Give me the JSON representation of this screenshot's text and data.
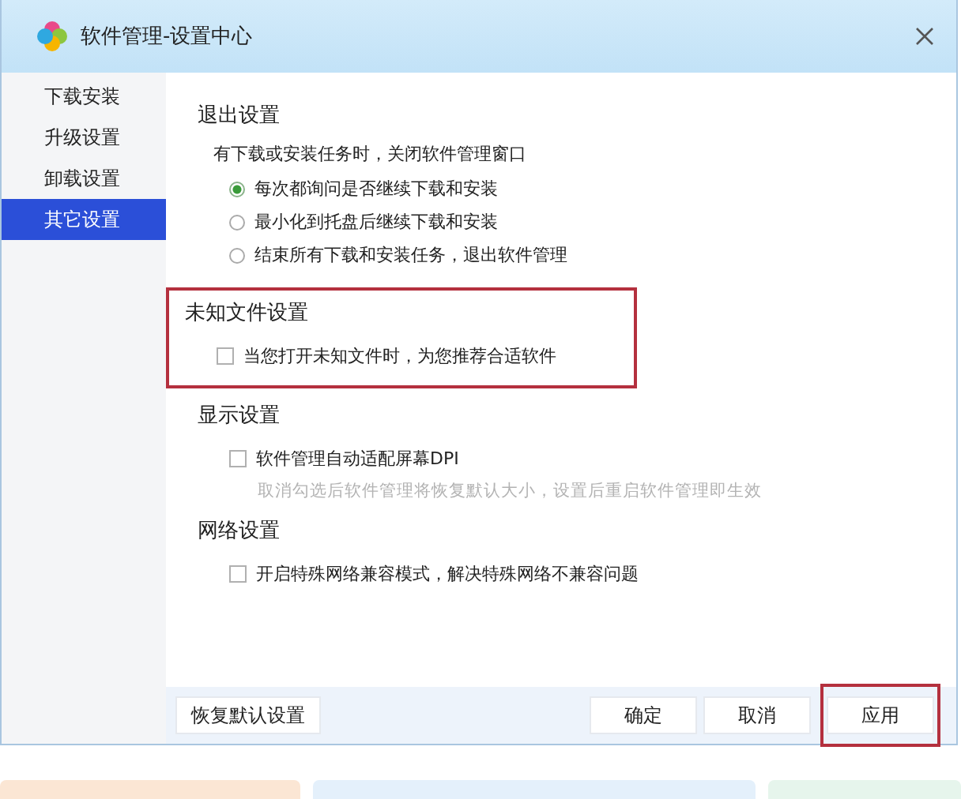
{
  "window": {
    "title": "软件管理-设置中心"
  },
  "sidebar": {
    "items": [
      {
        "label": "下载安装",
        "selected": false
      },
      {
        "label": "升级设置",
        "selected": false
      },
      {
        "label": "卸载设置",
        "selected": false
      },
      {
        "label": "其它设置",
        "selected": true
      }
    ]
  },
  "sections": [
    {
      "title": "退出设置",
      "highlighted": false,
      "note": "有下载或安装任务时，关闭软件管理窗口",
      "options": [
        {
          "kind": "radio",
          "label": "每次都询问是否继续下载和安装",
          "selected": true
        },
        {
          "kind": "radio",
          "label": "最小化到托盘后继续下载和安装",
          "selected": false
        },
        {
          "kind": "radio",
          "label": "结束所有下载和安装任务，退出软件管理",
          "selected": false
        }
      ]
    },
    {
      "title": "未知文件设置",
      "highlighted": true,
      "options": [
        {
          "kind": "checkbox",
          "label": "当您打开未知文件时，为您推荐合适软件",
          "checked": false
        }
      ]
    },
    {
      "title": "显示设置",
      "highlighted": false,
      "options": [
        {
          "kind": "checkbox",
          "label": "软件管理自动适配屏幕DPI",
          "checked": false,
          "hint": "取消勾选后软件管理将恢复默认大小，设置后重启软件管理即生效"
        }
      ]
    },
    {
      "title": "网络设置",
      "highlighted": false,
      "options": [
        {
          "kind": "checkbox",
          "label": "开启特殊网络兼容模式，解决特殊网络不兼容问题",
          "checked": false
        }
      ]
    }
  ],
  "footer": {
    "reset_button": "恢复默认设置",
    "buttons": [
      {
        "label": "确定",
        "highlighted": false
      },
      {
        "label": "取消",
        "highlighted": false
      },
      {
        "label": "应用",
        "highlighted": true
      }
    ]
  }
}
